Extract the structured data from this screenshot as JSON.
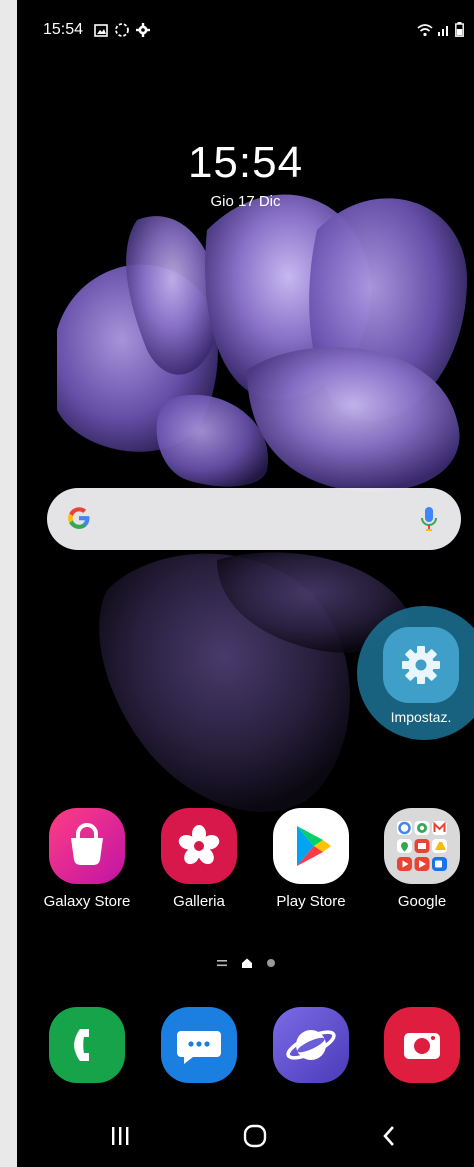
{
  "status_bar": {
    "time": "15:54",
    "left_icons": [
      "gallery-notification-icon",
      "sync-icon",
      "settings-notification-icon"
    ],
    "right_icons": [
      "wifi-icon",
      "signal-icon",
      "battery-icon"
    ]
  },
  "lockscreen": {
    "clock": "15:54",
    "date": "Gio 17 Dic"
  },
  "search_bar": {
    "left_icon": "google-g-icon",
    "right_icon": "microphone-icon"
  },
  "highlighted_app": {
    "label": "Impostaz.",
    "icon": "gear-icon",
    "highlight_color": "#1b7092"
  },
  "home_apps": [
    {
      "label": "Galaxy Store",
      "icon": "shopping-bag-icon",
      "color": "#d8197c"
    },
    {
      "label": "Galleria",
      "icon": "flower-icon",
      "color": "#d8174b"
    },
    {
      "label": "Play Store",
      "icon": "play-triangle-icon",
      "color": "#ffffff"
    },
    {
      "label": "Google",
      "icon": "google-folder-icon",
      "color": "#d9d9d9"
    }
  ],
  "page_indicator": {
    "items": [
      "list-indicator-icon",
      "home-indicator-icon",
      "page-dot-icon"
    ],
    "current": 1
  },
  "dock_apps": [
    {
      "icon": "phone-icon",
      "color": "#17a34a"
    },
    {
      "icon": "messages-icon",
      "color": "#1a7fe0"
    },
    {
      "icon": "internet-icon",
      "color": "#6b5cd8"
    },
    {
      "icon": "camera-icon",
      "color": "#df1d3f"
    }
  ],
  "nav_bar": {
    "items": [
      "recent-apps-icon",
      "home-icon",
      "back-icon"
    ]
  }
}
